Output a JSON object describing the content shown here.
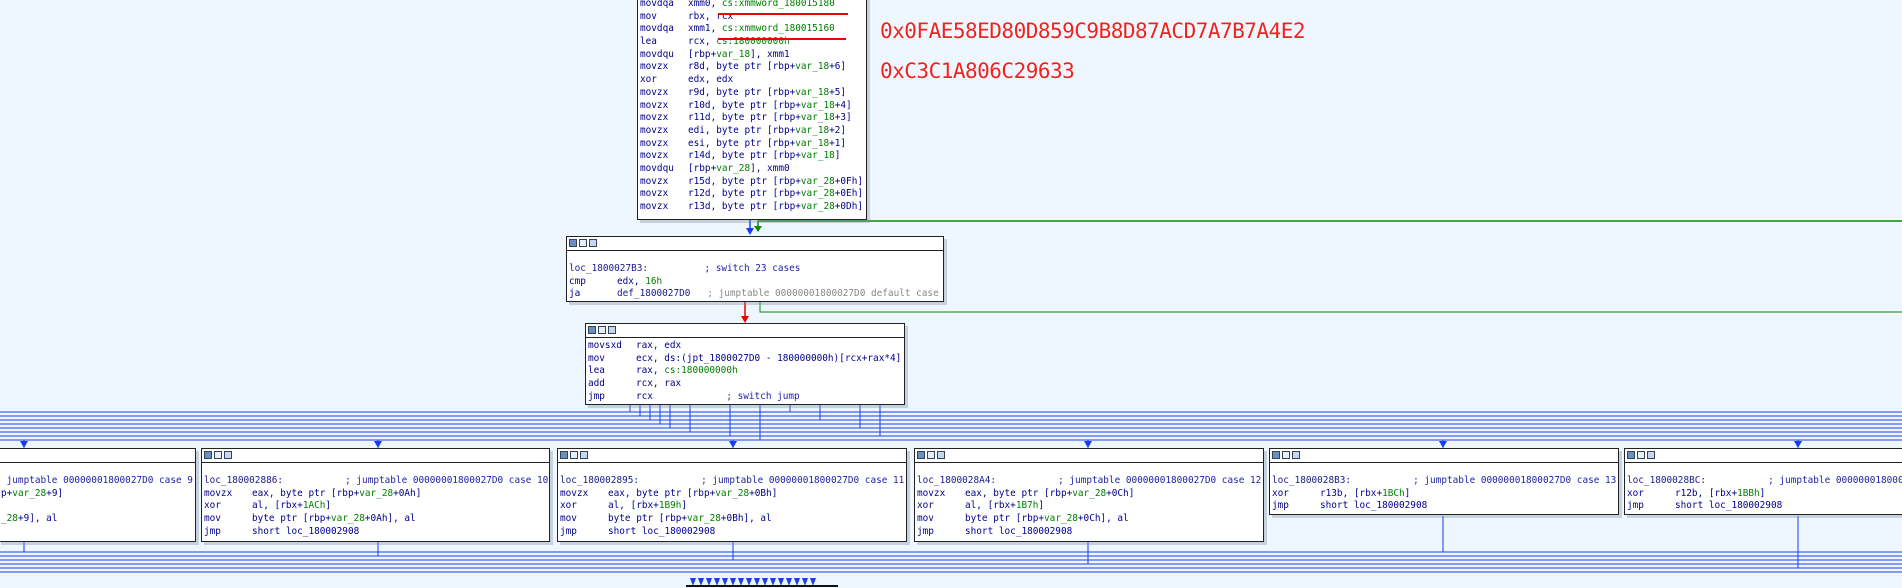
{
  "annotations": {
    "hash1": "0x0FAE58ED80D859C9B8D87ACD7A7B7A4E2",
    "hash2": "0xC3C1A806C29633"
  },
  "blocks": {
    "top": {
      "lines": [
        {
          "m": "movdqa",
          "ops": [
            {
              "t": "xmm0, "
            },
            {
              "t": "cs:xmmword_180015180",
              "c": "var"
            }
          ]
        },
        {
          "m": "mov",
          "ops": [
            {
              "t": "rbx, rcx"
            }
          ]
        },
        {
          "m": "movdqa",
          "ops": [
            {
              "t": "xmm1, "
            },
            {
              "t": "cs:xmmword_180015160",
              "c": "var"
            }
          ]
        },
        {
          "m": "lea",
          "ops": [
            {
              "t": "rcx, "
            },
            {
              "t": "cs:180000000h",
              "c": "num"
            }
          ]
        },
        {
          "m": "movdqu",
          "ops": [
            {
              "t": "[rbp+"
            },
            {
              "t": "var_18",
              "c": "var"
            },
            {
              "t": "], xmm1"
            }
          ]
        },
        {
          "m": "movzx",
          "ops": [
            {
              "t": "r8d, byte ptr [rbp+"
            },
            {
              "t": "var_18",
              "c": "var"
            },
            {
              "t": "+6]"
            }
          ]
        },
        {
          "m": "xor",
          "ops": [
            {
              "t": "edx, edx"
            }
          ]
        },
        {
          "m": "movzx",
          "ops": [
            {
              "t": "r9d, byte ptr [rbp+"
            },
            {
              "t": "var_18",
              "c": "var"
            },
            {
              "t": "+5]"
            }
          ]
        },
        {
          "m": "movzx",
          "ops": [
            {
              "t": "r10d, byte ptr [rbp+"
            },
            {
              "t": "var_18",
              "c": "var"
            },
            {
              "t": "+4]"
            }
          ]
        },
        {
          "m": "movzx",
          "ops": [
            {
              "t": "r11d, byte ptr [rbp+"
            },
            {
              "t": "var_18",
              "c": "var"
            },
            {
              "t": "+3]"
            }
          ]
        },
        {
          "m": "movzx",
          "ops": [
            {
              "t": "edi, byte ptr [rbp+"
            },
            {
              "t": "var_18",
              "c": "var"
            },
            {
              "t": "+2]"
            }
          ]
        },
        {
          "m": "movzx",
          "ops": [
            {
              "t": "esi, byte ptr [rbp+"
            },
            {
              "t": "var_18",
              "c": "var"
            },
            {
              "t": "+1]"
            }
          ]
        },
        {
          "m": "movzx",
          "ops": [
            {
              "t": "r14d, byte ptr [rbp+"
            },
            {
              "t": "var_18",
              "c": "var"
            },
            {
              "t": "]"
            }
          ]
        },
        {
          "m": "movdqu",
          "ops": [
            {
              "t": "[rbp+"
            },
            {
              "t": "var_28",
              "c": "var"
            },
            {
              "t": "], xmm0"
            }
          ]
        },
        {
          "m": "movzx",
          "ops": [
            {
              "t": "r15d, byte ptr [rbp+"
            },
            {
              "t": "var_28",
              "c": "var"
            },
            {
              "t": "+0Fh]"
            }
          ]
        },
        {
          "m": "movzx",
          "ops": [
            {
              "t": "r12d, byte ptr [rbp+"
            },
            {
              "t": "var_28",
              "c": "var"
            },
            {
              "t": "+0Eh]"
            }
          ]
        },
        {
          "m": "movzx",
          "ops": [
            {
              "t": "r13d, byte ptr [rbp+"
            },
            {
              "t": "var_28",
              "c": "var"
            },
            {
              "t": "+0Dh]"
            }
          ]
        }
      ]
    },
    "switch": {
      "lines": [
        {
          "raw": [
            {
              "t": "loc_1800027B3:",
              "c": "lbl"
            },
            {
              "t": "          "
            },
            {
              "t": "; switch 23 cases",
              "c": "cmt"
            }
          ]
        },
        {
          "m": "cmp",
          "ops": [
            {
              "t": "edx, "
            },
            {
              "t": "16h",
              "c": "num"
            }
          ]
        },
        {
          "m": "ja",
          "ops": [
            {
              "t": "def_1800027D0",
              "c": "lbl"
            },
            {
              "t": "   "
            },
            {
              "t": "; jumptable 00000001800027D0 default case",
              "c": "cmtg"
            }
          ]
        }
      ]
    },
    "jump": {
      "lines": [
        {
          "m": "movsxd",
          "ops": [
            {
              "t": "rax, edx"
            }
          ]
        },
        {
          "m": "mov",
          "ops": [
            {
              "t": "ecx, ds:(jpt_1800027D0 - 180000000h)[rcx+rax*4]"
            }
          ]
        },
        {
          "m": "lea",
          "ops": [
            {
              "t": "rax, "
            },
            {
              "t": "cs:180000000h",
              "c": "num"
            }
          ]
        },
        {
          "m": "add",
          "ops": [
            {
              "t": "rcx, rax"
            }
          ]
        },
        {
          "m": "jmp",
          "ops": [
            {
              "t": "rcx"
            },
            {
              "t": "             "
            },
            {
              "t": "; switch jump",
              "c": "cmt"
            }
          ]
        }
      ]
    },
    "case9": {
      "lines": [
        {
          "raw": [
            {
              "t": " jumptable 00000001800027D0 case 9",
              "c": "cmt"
            }
          ]
        },
        {
          "raw": [
            {
              "t": "p+"
            },
            {
              "t": "var_28",
              "c": "var"
            },
            {
              "t": "+9]"
            }
          ]
        },
        {
          "raw": [
            {
              "t": ""
            }
          ]
        },
        {
          "raw": [
            {
              "t": "_28",
              "c": "var"
            },
            {
              "t": "+9], al"
            }
          ]
        }
      ]
    },
    "case10": {
      "lines": [
        {
          "raw": [
            {
              "t": "loc_180002886:",
              "c": "lbl"
            },
            {
              "t": "           "
            },
            {
              "t": "; jumptable 00000001800027D0 case 10",
              "c": "cmt"
            }
          ]
        },
        {
          "m": "movzx",
          "ops": [
            {
              "t": "eax, byte ptr [rbp+"
            },
            {
              "t": "var_28",
              "c": "var"
            },
            {
              "t": "+0Ah]"
            }
          ]
        },
        {
          "m": "xor",
          "ops": [
            {
              "t": "al, [rbx+"
            },
            {
              "t": "1ACh",
              "c": "num"
            },
            {
              "t": "]"
            }
          ]
        },
        {
          "m": "mov",
          "ops": [
            {
              "t": "byte ptr [rbp+"
            },
            {
              "t": "var_28",
              "c": "var"
            },
            {
              "t": "+0Ah], al"
            }
          ]
        },
        {
          "m": "jmp",
          "ops": [
            {
              "t": "short loc_180002908"
            }
          ]
        }
      ]
    },
    "case11": {
      "lines": [
        {
          "raw": [
            {
              "t": "loc_180002895:",
              "c": "lbl"
            },
            {
              "t": "           "
            },
            {
              "t": "; jumptable 00000001800027D0 case 11",
              "c": "cmt"
            }
          ]
        },
        {
          "m": "movzx",
          "ops": [
            {
              "t": "eax, byte ptr [rbp+"
            },
            {
              "t": "var_28",
              "c": "var"
            },
            {
              "t": "+0Bh]"
            }
          ]
        },
        {
          "m": "xor",
          "ops": [
            {
              "t": "al, [rbx+"
            },
            {
              "t": "1B9h",
              "c": "num"
            },
            {
              "t": "]"
            }
          ]
        },
        {
          "m": "mov",
          "ops": [
            {
              "t": "byte ptr [rbp+"
            },
            {
              "t": "var_28",
              "c": "var"
            },
            {
              "t": "+0Bh], al"
            }
          ]
        },
        {
          "m": "jmp",
          "ops": [
            {
              "t": "short loc_180002908"
            }
          ]
        }
      ]
    },
    "case12": {
      "lines": [
        {
          "raw": [
            {
              "t": "loc_1800028A4:",
              "c": "lbl"
            },
            {
              "t": "           "
            },
            {
              "t": "; jumptable 00000001800027D0 case 12",
              "c": "cmt"
            }
          ]
        },
        {
          "m": "movzx",
          "ops": [
            {
              "t": "eax, byte ptr [rbp+"
            },
            {
              "t": "var_28",
              "c": "var"
            },
            {
              "t": "+0Ch]"
            }
          ]
        },
        {
          "m": "xor",
          "ops": [
            {
              "t": "al, [rbx+"
            },
            {
              "t": "1B7h",
              "c": "num"
            },
            {
              "t": "]"
            }
          ]
        },
        {
          "m": "mov",
          "ops": [
            {
              "t": "byte ptr [rbp+"
            },
            {
              "t": "var_28",
              "c": "var"
            },
            {
              "t": "+0Ch], al"
            }
          ]
        },
        {
          "m": "jmp",
          "ops": [
            {
              "t": "short loc_180002908"
            }
          ]
        }
      ]
    },
    "case13": {
      "lines": [
        {
          "raw": [
            {
              "t": "loc_1800028B3:",
              "c": "lbl"
            },
            {
              "t": "           "
            },
            {
              "t": "; jumptable 00000001800027D0 case 13",
              "c": "cmt"
            }
          ]
        },
        {
          "m": "xor",
          "ops": [
            {
              "t": "r13b, [rbx+"
            },
            {
              "t": "1BCh",
              "c": "num"
            },
            {
              "t": "]"
            }
          ]
        },
        {
          "m": "jmp",
          "ops": [
            {
              "t": "short loc_180002908"
            }
          ]
        }
      ]
    },
    "case14": {
      "lines": [
        {
          "raw": [
            {
              "t": "loc_1800028BC:",
              "c": "lbl"
            },
            {
              "t": "           "
            },
            {
              "t": "; jumptable 0000000180002",
              "c": "cmt"
            }
          ]
        },
        {
          "m": "xor",
          "ops": [
            {
              "t": "r12b, [rbx+"
            },
            {
              "t": "1BBh",
              "c": "num"
            },
            {
              "t": "]"
            }
          ]
        },
        {
          "m": "jmp",
          "ops": [
            {
              "t": "short loc_180002908"
            }
          ]
        }
      ]
    }
  },
  "colors": {
    "background": "#eef7ff",
    "edge_normal": "#1a3cf0",
    "edge_true": "#007700",
    "edge_false": "#e00000",
    "annotation": "#ee2222"
  }
}
